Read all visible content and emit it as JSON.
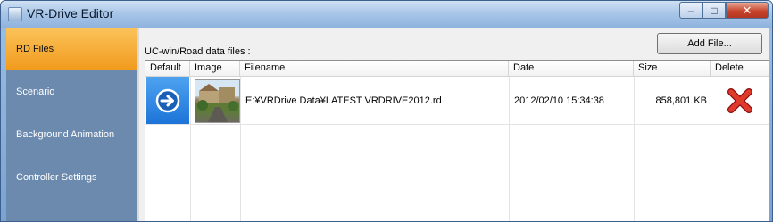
{
  "window": {
    "title": "VR-Drive Editor",
    "min_label": "–",
    "max_label": "□",
    "close_label": "✕"
  },
  "sidebar": {
    "items": [
      {
        "label": "RD Files",
        "active": true
      },
      {
        "label": "Scenario",
        "active": false
      },
      {
        "label": "Background Animation",
        "active": false
      },
      {
        "label": "Controller Settings",
        "active": false
      }
    ]
  },
  "main": {
    "section_label": "UC-win/Road data files :",
    "add_file_label": "Add File...",
    "columns": [
      "Default",
      "Image",
      "Filename",
      "Date",
      "Size",
      "Delete"
    ],
    "rows": [
      {
        "filename": "E:¥VRDrive Data¥LATEST VRDRIVE2012.rd",
        "date": "2012/02/10 15:34:38",
        "size": "858,801 KB"
      }
    ]
  },
  "colors": {
    "accent": "#f19a1c",
    "sidebar": "#6c8aae",
    "default_icon": "#1d74d8",
    "delete_icon": "#d02020"
  }
}
